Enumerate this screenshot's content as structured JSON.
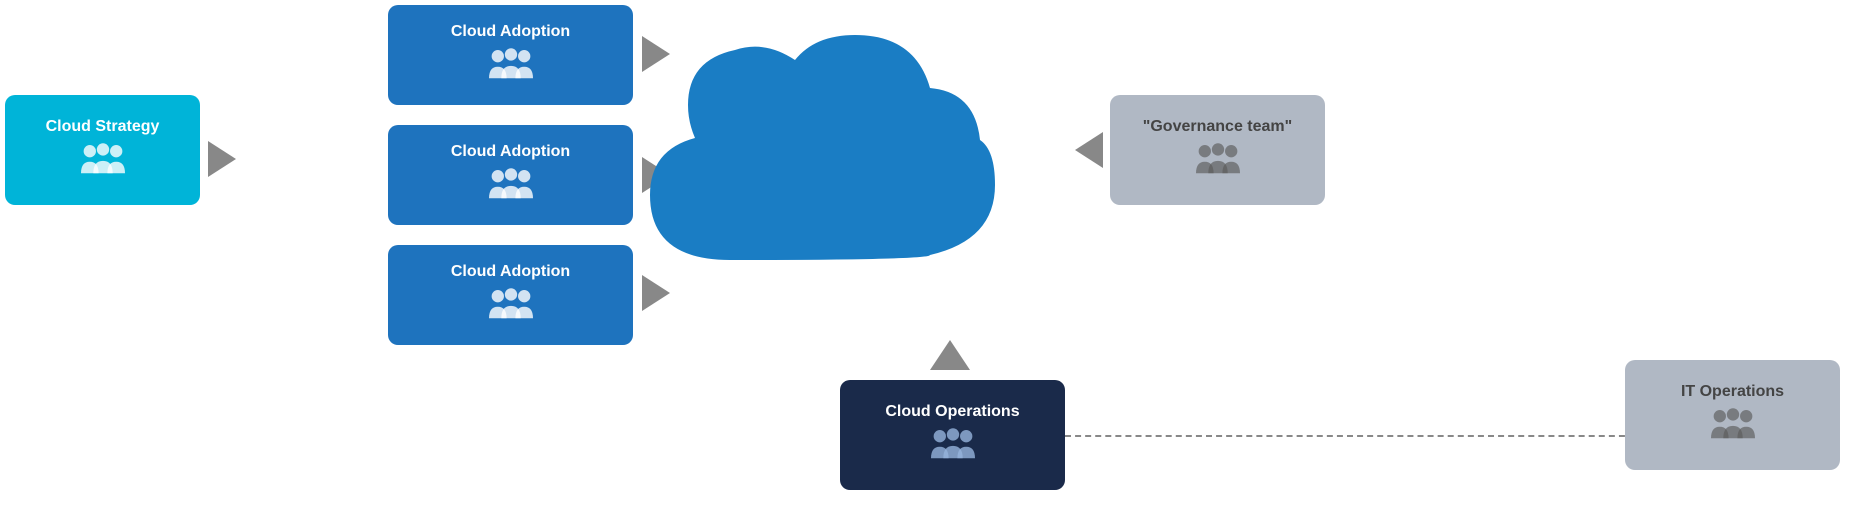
{
  "boxes": {
    "cloud_strategy": {
      "label": "Cloud Strategy",
      "icon": "people"
    },
    "cloud_adoption_1": {
      "label": "Cloud Adoption",
      "icon": "people"
    },
    "cloud_adoption_2": {
      "label": "Cloud Adoption",
      "icon": "people"
    },
    "cloud_adoption_3": {
      "label": "Cloud Adoption",
      "icon": "people"
    },
    "cloud_operations": {
      "label": "Cloud Operations",
      "icon": "people"
    },
    "governance_team": {
      "label": "\"Governance team\"",
      "icon": "people"
    },
    "it_operations": {
      "label": "IT Operations",
      "icon": "people"
    }
  },
  "colors": {
    "cyan": "#00b4d8",
    "blue": "#1e73be",
    "navy": "#1a2a4a",
    "gray": "#b0b8c4",
    "arrow": "#888888",
    "cloud_blue": "#1a7dc4"
  }
}
